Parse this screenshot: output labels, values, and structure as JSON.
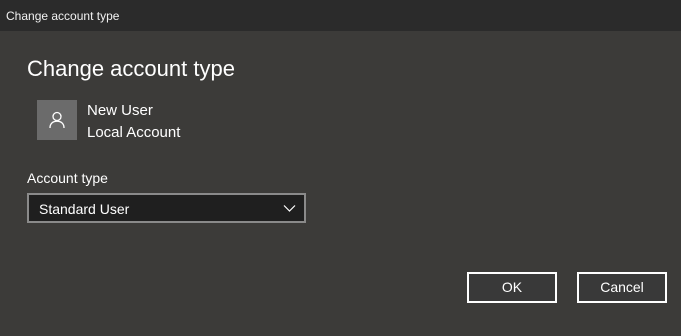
{
  "window": {
    "title": "Change account type"
  },
  "dialog": {
    "heading": "Change account type",
    "user": {
      "name": "New User",
      "account_kind": "Local Account",
      "avatar_icon": "person-icon"
    },
    "account_type": {
      "label": "Account type",
      "selected": "Standard User"
    },
    "buttons": {
      "ok": "OK",
      "cancel": "Cancel"
    }
  },
  "colors": {
    "background": "#3c3b39",
    "titlebar": "#2b2b2b",
    "avatar": "#6b6b6b",
    "select_bg": "#1f1f1f",
    "select_border": "#8a8a8a",
    "button_border": "#ffffff"
  }
}
